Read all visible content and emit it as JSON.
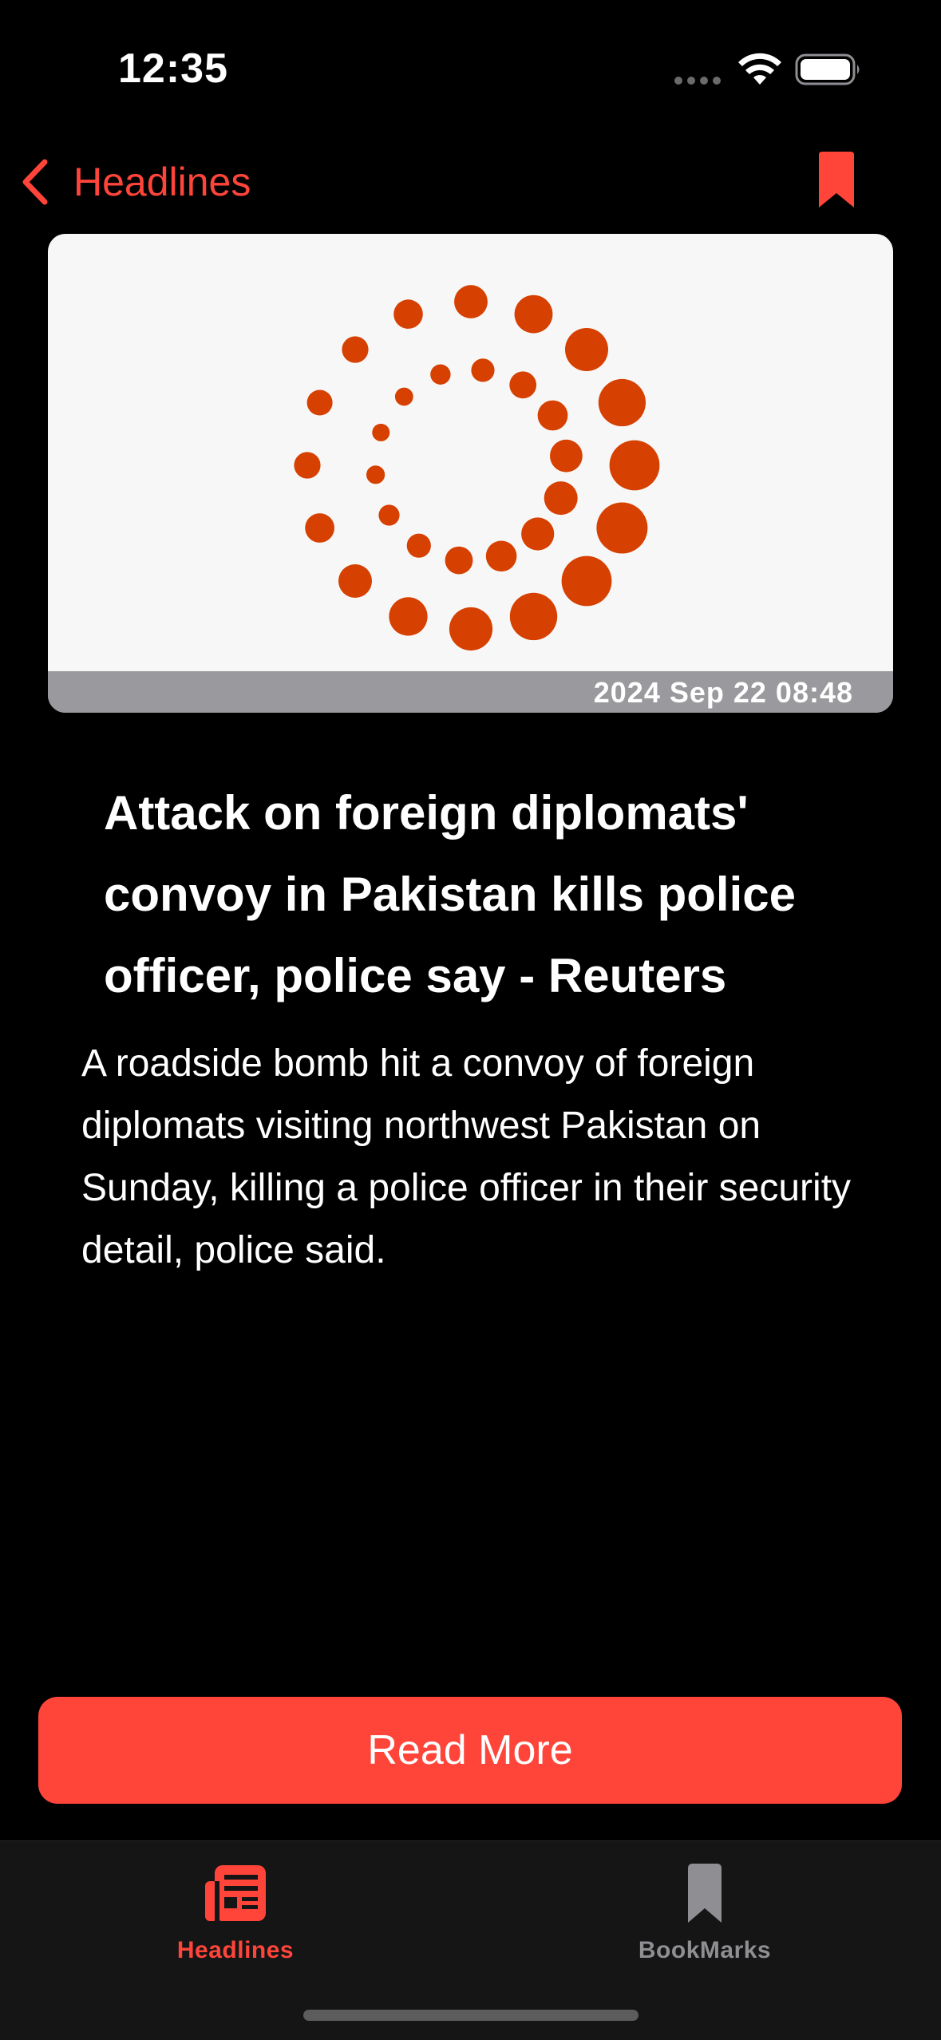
{
  "status_bar": {
    "time": "12:35"
  },
  "nav": {
    "back_label": "Headlines",
    "bookmark_icon": "bookmark-fill-icon",
    "accent_color": "#ff453a"
  },
  "article": {
    "image_logo": "reuters-logo",
    "date": "2024 Sep 22 08:48",
    "title": "Attack on foreign diplomats' convoy in Pakistan kills police officer, police say - Reuters",
    "description": "A roadside bomb hit a convoy of foreign diplomats visiting northwest Pakistan on Sunday, killing a police officer in their security detail, police said.",
    "read_more_label": "Read More"
  },
  "tabs": [
    {
      "label": "Headlines",
      "icon": "newspaper-icon",
      "active": true
    },
    {
      "label": "BookMarks",
      "icon": "bookmark-icon",
      "active": false
    }
  ],
  "colors": {
    "accent": "#ff453a",
    "logo_orange": "#d64000",
    "inactive": "#8e8e93"
  }
}
